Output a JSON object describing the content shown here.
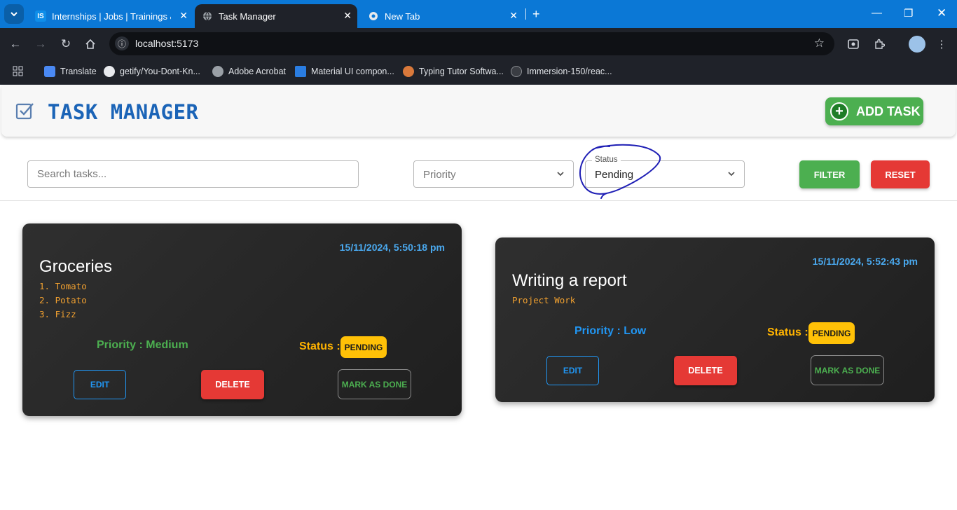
{
  "browser": {
    "tabs": [
      {
        "title": "Internships | Jobs | Trainings & I",
        "favicon": "IS"
      },
      {
        "title": "Task Manager"
      },
      {
        "title": "New Tab"
      }
    ],
    "url": "localhost:5173",
    "bookmarks": [
      {
        "label": "Translate",
        "icon": "translate-icon"
      },
      {
        "label": "getify/You-Dont-Kn...",
        "icon": "github-icon"
      },
      {
        "label": "Adobe Acrobat",
        "icon": "globe-icon"
      },
      {
        "label": "Material UI compon...",
        "icon": "mui-icon"
      },
      {
        "label": "Typing Tutor Softwa...",
        "icon": "typing-icon"
      },
      {
        "label": "Immersion-150/reac...",
        "icon": "github-icon"
      }
    ]
  },
  "header": {
    "title": "TASK MANAGER",
    "add_label": "ADD TASK"
  },
  "filters": {
    "search_placeholder": "Search tasks...",
    "priority_placeholder": "Priority",
    "status_label": "Status",
    "status_value": "Pending",
    "filter_label": "FILTER",
    "reset_label": "RESET"
  },
  "tasks": [
    {
      "date": "15/11/2024, 5:50:18 pm",
      "title": "Groceries",
      "description": [
        "1. Tomato",
        "2. Potato",
        "3. Fizz"
      ],
      "priority_text": "Priority : Medium",
      "priority_color": "#4caf50",
      "status_label": "Status :",
      "status": "PENDING",
      "edit_label": "EDIT",
      "delete_label": "DELETE",
      "done_label": "MARK AS DONE"
    },
    {
      "date": "15/11/2024, 5:52:43 pm",
      "title": "Writing a report",
      "description": [
        "Project Work"
      ],
      "priority_text": "Priority : Low",
      "priority_color": "#2196f3",
      "status_label": "Status :",
      "status": "PENDING",
      "edit_label": "EDIT",
      "delete_label": "DELETE",
      "done_label": "MARK AS DONE"
    }
  ],
  "colors": {
    "brand_blue": "#1b64b7",
    "success_green": "#4caf50",
    "danger_red": "#e53935",
    "pending_yellow": "#ffc107",
    "chrome_tabbar": "#0b78d6"
  }
}
